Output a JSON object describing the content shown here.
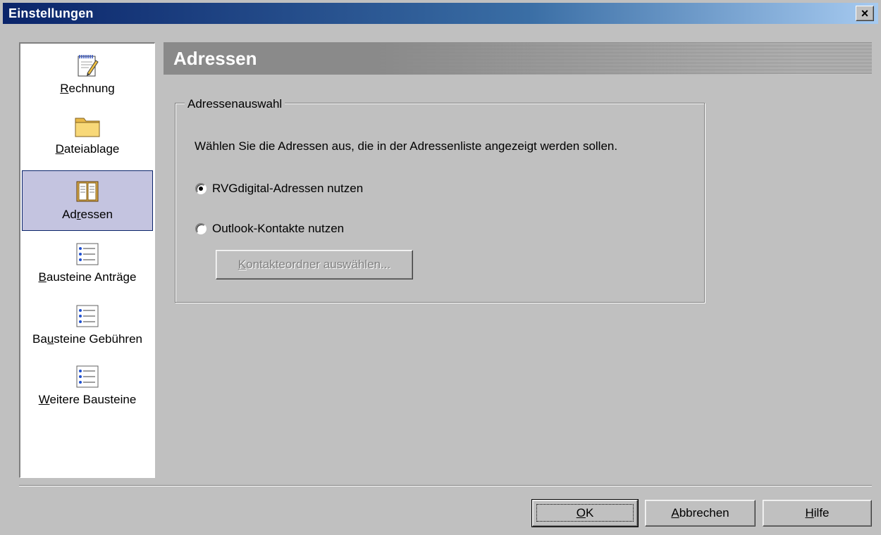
{
  "window": {
    "title": "Einstellungen",
    "close_glyph": "×"
  },
  "sidebar": {
    "items": [
      {
        "icon": "notepad-pencil-icon",
        "pre": "",
        "key": "R",
        "post": "echnung"
      },
      {
        "icon": "folder-icon",
        "pre": "",
        "key": "D",
        "post": "ateiablage"
      },
      {
        "icon": "address-book-icon",
        "pre": "Ad",
        "key": "r",
        "post": "essen",
        "selected": true
      },
      {
        "icon": "document-list-icon",
        "pre": "",
        "key": "B",
        "post": "austeine Anträge"
      },
      {
        "icon": "document-list-icon",
        "pre": "Ba",
        "key": "u",
        "post": "steine Gebühren"
      },
      {
        "icon": "document-list-icon",
        "pre": "",
        "key": "W",
        "post": "eitere Bausteine"
      }
    ]
  },
  "main": {
    "header": "Adressen",
    "group": {
      "legend": "Adressenauswahl",
      "description": "Wählen Sie die Adressen aus, die in der Adressenliste angezeigt werden sollen.",
      "options": [
        {
          "label": "RVGdigital-Adressen nutzen",
          "checked": true
        },
        {
          "label": "Outlook-Kontakte nutzen",
          "checked": false
        }
      ],
      "select_folder": {
        "key": "K",
        "rest": "ontakteordner auswählen..."
      }
    }
  },
  "footer": {
    "ok": {
      "key": "O",
      "rest": "K"
    },
    "cancel": {
      "key": "A",
      "rest": "bbrechen"
    },
    "help": {
      "key": "H",
      "rest": "ilfe"
    }
  }
}
